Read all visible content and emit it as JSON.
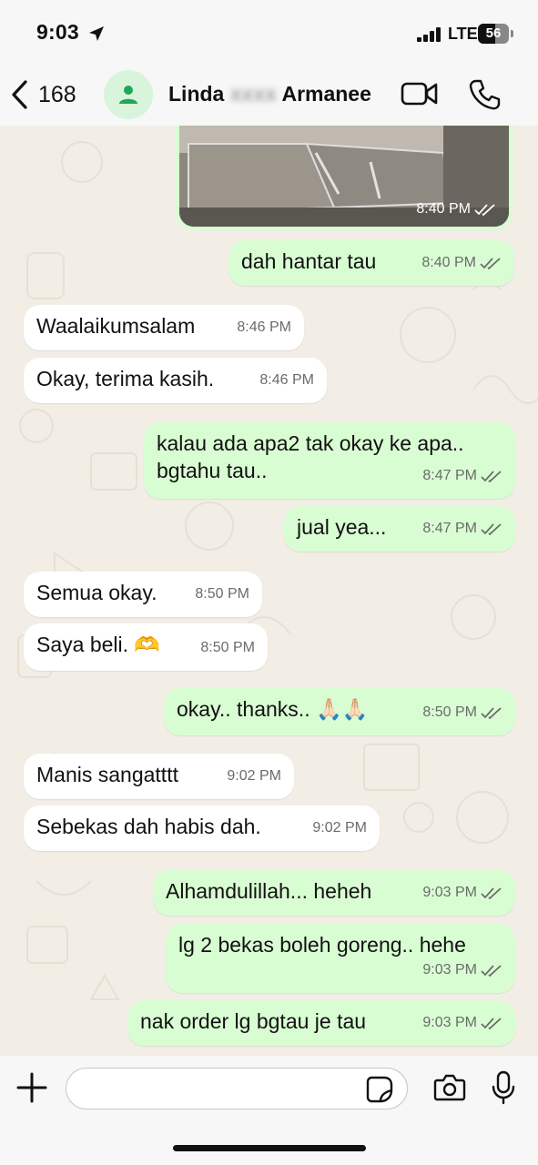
{
  "status_bar": {
    "time": "9:03",
    "network": "LTE",
    "battery": "56",
    "battery_level": 0.56
  },
  "header": {
    "back_count": "168",
    "contact_name_first": "Linda",
    "contact_name_hidden": "xxxx",
    "contact_name_last": "Armanee"
  },
  "messages": [
    {
      "type": "image",
      "dir": "out",
      "time": "8:40 PM"
    },
    {
      "dir": "out",
      "text": "dah hantar tau",
      "time": "8:40 PM"
    },
    {
      "dir": "in",
      "text": "Waalaikumsalam",
      "time": "8:46 PM"
    },
    {
      "dir": "in",
      "text": "Okay, terima kasih.",
      "time": "8:46 PM"
    },
    {
      "dir": "out",
      "text": "kalau ada apa2 tak okay ke apa..",
      "text2": "bgtahu tau..",
      "time": "8:47 PM"
    },
    {
      "dir": "out",
      "text": "jual yea...",
      "time": "8:47 PM"
    },
    {
      "dir": "in",
      "text": "Semua okay.",
      "time": "8:50 PM"
    },
    {
      "dir": "in",
      "text": "Saya beli. 🫶",
      "time": "8:50 PM"
    },
    {
      "dir": "out",
      "text": "okay.. thanks.. 🙏🏻🙏🏻",
      "time": "8:50 PM"
    },
    {
      "dir": "in",
      "text": "Manis sangatttt",
      "time": "9:02 PM"
    },
    {
      "dir": "in",
      "text": "Sebekas dah habis dah.",
      "time": "9:02 PM"
    },
    {
      "dir": "out",
      "text": "Alhamdulillah... heheh",
      "time": "9:03 PM"
    },
    {
      "dir": "out",
      "text": "lg 2 bekas boleh goreng.. hehe",
      "time": "9:03 PM"
    },
    {
      "dir": "out",
      "text": "nak order lg bgtau je tau",
      "time": "9:03 PM"
    }
  ],
  "input": {
    "value": "",
    "placeholder": ""
  },
  "icons": {
    "location": "location-arrow-icon",
    "back": "chevron-left-icon",
    "avatar": "person-icon",
    "video": "video-call-icon",
    "call": "phone-icon",
    "plus": "plus-icon",
    "sticker": "sticker-icon",
    "camera": "camera-icon",
    "mic": "microphone-icon",
    "read": "double-check-icon"
  },
  "colors": {
    "outgoing_bubble": "#d9fdd3",
    "incoming_bubble": "#ffffff",
    "accent": "#1fa855",
    "chat_bg": "#f2eee6"
  }
}
